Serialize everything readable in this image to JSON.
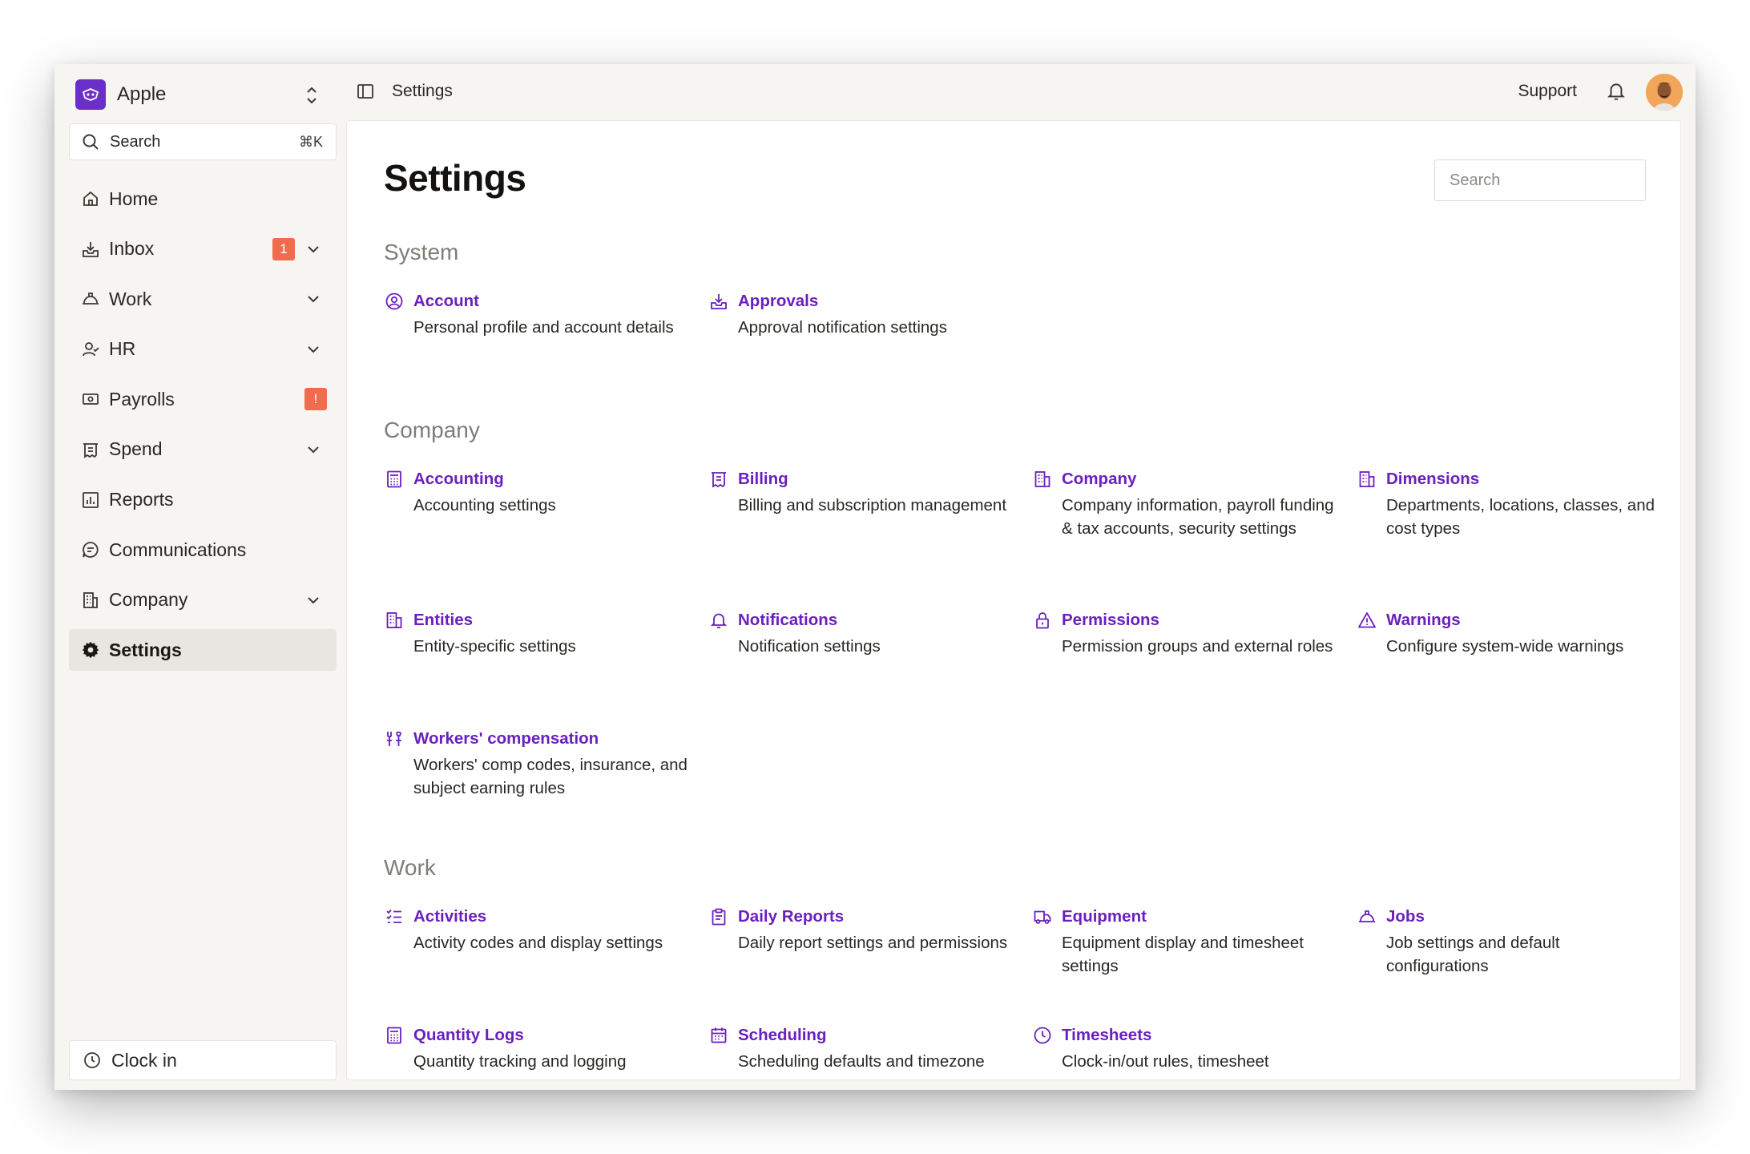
{
  "org": {
    "name": "Apple"
  },
  "sidebar": {
    "search_label": "Search",
    "search_shortcut": "⌘K",
    "items": [
      {
        "label": "Home",
        "icon": "home-icon"
      },
      {
        "label": "Inbox",
        "icon": "inbox-icon",
        "badge": "1"
      },
      {
        "label": "Work",
        "icon": "work-icon"
      },
      {
        "label": "HR",
        "icon": "hr-icon"
      },
      {
        "label": "Payrolls",
        "icon": "payrolls-icon",
        "badge": "!"
      },
      {
        "label": "Spend",
        "icon": "spend-icon"
      },
      {
        "label": "Reports",
        "icon": "reports-icon"
      },
      {
        "label": "Communications",
        "icon": "communications-icon"
      },
      {
        "label": "Company",
        "icon": "company-icon"
      },
      {
        "label": "Settings",
        "icon": "settings-icon",
        "active": true
      }
    ],
    "clock_in": "Clock in"
  },
  "topbar": {
    "breadcrumb": "Settings",
    "support": "Support"
  },
  "page": {
    "title": "Settings",
    "search_placeholder": "Search"
  },
  "sections": {
    "system": {
      "title": "System",
      "cards": [
        {
          "title": "Account",
          "desc": "Personal profile and account details",
          "icon": "user-circle-icon"
        },
        {
          "title": "Approvals",
          "desc": "Approval notification settings",
          "icon": "approvals-icon"
        }
      ]
    },
    "company": {
      "title": "Company",
      "cards": [
        {
          "title": "Accounting",
          "desc": "Accounting settings",
          "icon": "calculator-icon"
        },
        {
          "title": "Billing",
          "desc": "Billing and subscription management",
          "icon": "billing-icon"
        },
        {
          "title": "Company",
          "desc": "Company information, payroll funding & tax accounts, security settings",
          "icon": "building-icon"
        },
        {
          "title": "Dimensions",
          "desc": "Departments, locations, classes, and cost types",
          "icon": "dimensions-icon"
        },
        {
          "title": "Entities",
          "desc": "Entity-specific settings",
          "icon": "entities-icon"
        },
        {
          "title": "Notifications",
          "desc": "Notification settings",
          "icon": "bell-icon"
        },
        {
          "title": "Permissions",
          "desc": "Permission groups and external roles",
          "icon": "lock-icon"
        },
        {
          "title": "Warnings",
          "desc": "Configure system-wide warnings",
          "icon": "warning-icon"
        },
        {
          "title": "Workers' compensation",
          "desc": "Workers' comp codes, insurance, and subject earning rules",
          "icon": "tools-icon"
        }
      ]
    },
    "work": {
      "title": "Work",
      "cards": [
        {
          "title": "Activities",
          "desc": "Activity codes and display settings",
          "icon": "checklist-icon"
        },
        {
          "title": "Daily Reports",
          "desc": "Daily report settings and permissions",
          "icon": "clipboard-icon"
        },
        {
          "title": "Equipment",
          "desc": "Equipment display and timesheet settings",
          "icon": "truck-icon"
        },
        {
          "title": "Jobs",
          "desc": "Job settings and default configurations",
          "icon": "hardhat-icon"
        },
        {
          "title": "Quantity Logs",
          "desc": "Quantity tracking and logging",
          "icon": "quantity-icon"
        },
        {
          "title": "Scheduling",
          "desc": "Scheduling defaults and timezone",
          "icon": "calendar-icon"
        },
        {
          "title": "Timesheets",
          "desc": "Clock-in/out rules, timesheet",
          "icon": "clock-icon"
        }
      ]
    }
  },
  "colors": {
    "accent": "#6a1fbf",
    "badge": "#f26b4f",
    "logo": "#6b2fc9"
  }
}
